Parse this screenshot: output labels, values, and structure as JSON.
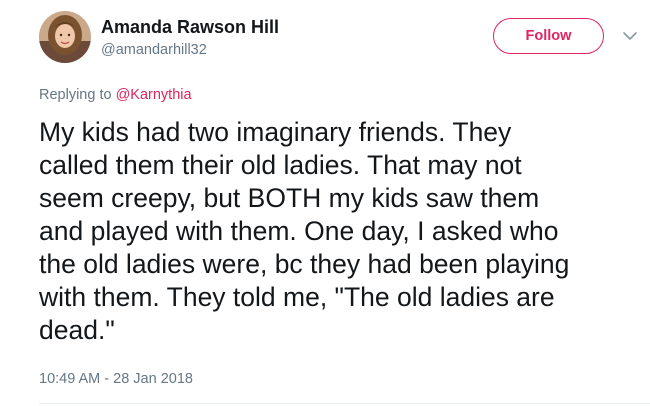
{
  "author": {
    "name": "Amanda Rawson Hill",
    "handle": "@amandarhill32"
  },
  "follow_label": "Follow",
  "reply": {
    "prefix": "Replying to ",
    "mention": "@Karnythia"
  },
  "tweet": {
    "text": "My kids had two imaginary friends. They\ncalled them their old ladies. That may not\nseem creepy, but BOTH my kids saw them\nand played with them. One day, I asked who\nthe old ladies were, bc they had been playing\nwith them. They told me, \"The old ladies are\ndead.\""
  },
  "timestamp": "10:49 AM - 28 Jan 2018",
  "colors": {
    "accent": "#e0245e",
    "text": "#14171a",
    "secondary": "#657786"
  },
  "icons": {
    "avatar": "profile-photo",
    "menu": "chevron-down-icon"
  }
}
